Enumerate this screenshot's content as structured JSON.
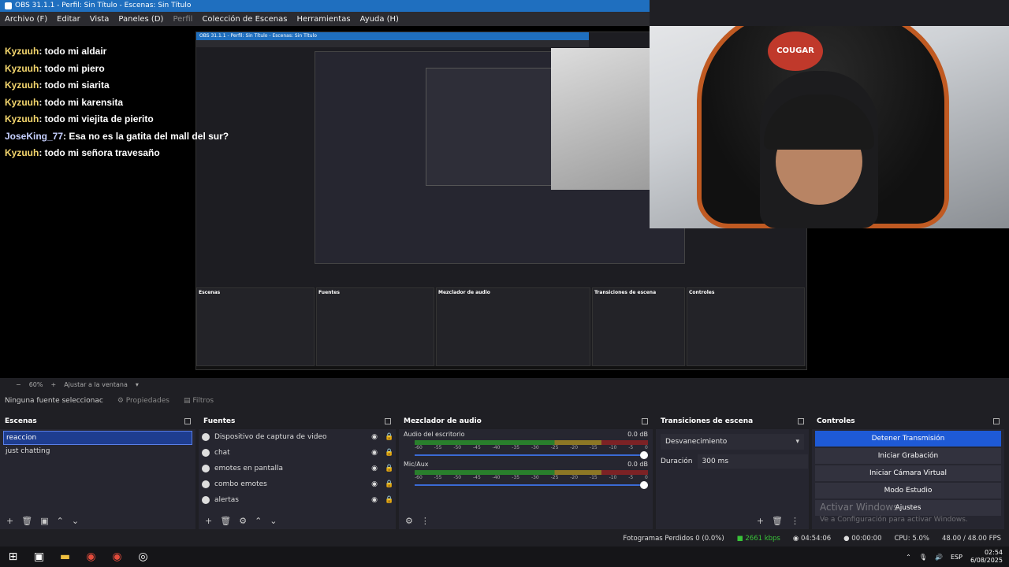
{
  "window": {
    "title": "OBS 31.1.1 - Perfil: Sin Título - Escenas: Sin Título"
  },
  "menu": [
    "Archivo (F)",
    "Editar",
    "Vista",
    "Paneles (D)",
    "Perfil",
    "Colección de Escenas",
    "Herramientas",
    "Ayuda (H)"
  ],
  "chat": [
    {
      "user": "Kyzuuh",
      "msg": ": todo mi aldair"
    },
    {
      "user": "Kyzuuh",
      "msg": ": todo mi piero"
    },
    {
      "user": "Kyzuuh",
      "msg": ": todo mi siarita"
    },
    {
      "user": "Kyzuuh",
      "msg": ": todo mi karensita"
    },
    {
      "user": "Kyzuuh",
      "msg": ": todo mi viejita de pierito"
    },
    {
      "user": "JoseKing_77",
      "msg": ": Esa no es la gatita del mall del sur?"
    },
    {
      "user": "Kyzuuh",
      "msg": ": todo mi señora travesaño"
    }
  ],
  "webcam": {
    "chair_brand": "COUGAR"
  },
  "preview_controls": {
    "zoom": "60%",
    "fit": "Ajustar a la ventana"
  },
  "properties_bar": {
    "selection": "Ninguna fuente seleccionac",
    "properties": "Propiedades",
    "filters": "Filtros"
  },
  "scenes": {
    "title": "Escenas",
    "items": [
      "reaccion",
      "just chatting"
    ]
  },
  "sources": {
    "title": "Fuentes",
    "items": [
      "Dispositivo de captura de video",
      "chat",
      "emotes en pantalla",
      "combo emotes",
      "alertas"
    ]
  },
  "mixer": {
    "title": "Mezclador de audio",
    "channels": [
      {
        "name": "Audio del escritorio",
        "db": "0.0 dB"
      },
      {
        "name": "Mic/Aux",
        "db": "0.0 dB"
      }
    ],
    "ticks": [
      "-60",
      "-55",
      "-50",
      "-45",
      "-40",
      "-35",
      "-30",
      "-25",
      "-20",
      "-15",
      "-10",
      "-5",
      "0"
    ]
  },
  "transitions": {
    "title": "Transiciones de escena",
    "selected": "Desvanecimiento",
    "duration_label": "Duración",
    "duration": "300 ms"
  },
  "controls": {
    "title": "Controles",
    "buttons": [
      "Detener Transmisión",
      "Iniciar Grabación",
      "Iniciar Cámara Virtual",
      "Modo Estudio",
      "Ajustes"
    ],
    "watermark_title": "Activar Windows",
    "watermark_sub": "Ve a Configuración para activar Windows."
  },
  "status": {
    "dropped": "Fotogramas Perdidos 0 (0.0%)",
    "bitrate": "2661 kbps",
    "stream_time": "04:54:06",
    "rec_time": "00:00:00",
    "cpu": "CPU: 5.0%",
    "fps": "48.00 / 48.00 FPS"
  },
  "taskbar": {
    "lang": "ESP",
    "time": "02:54",
    "date": "6/08/2025"
  }
}
